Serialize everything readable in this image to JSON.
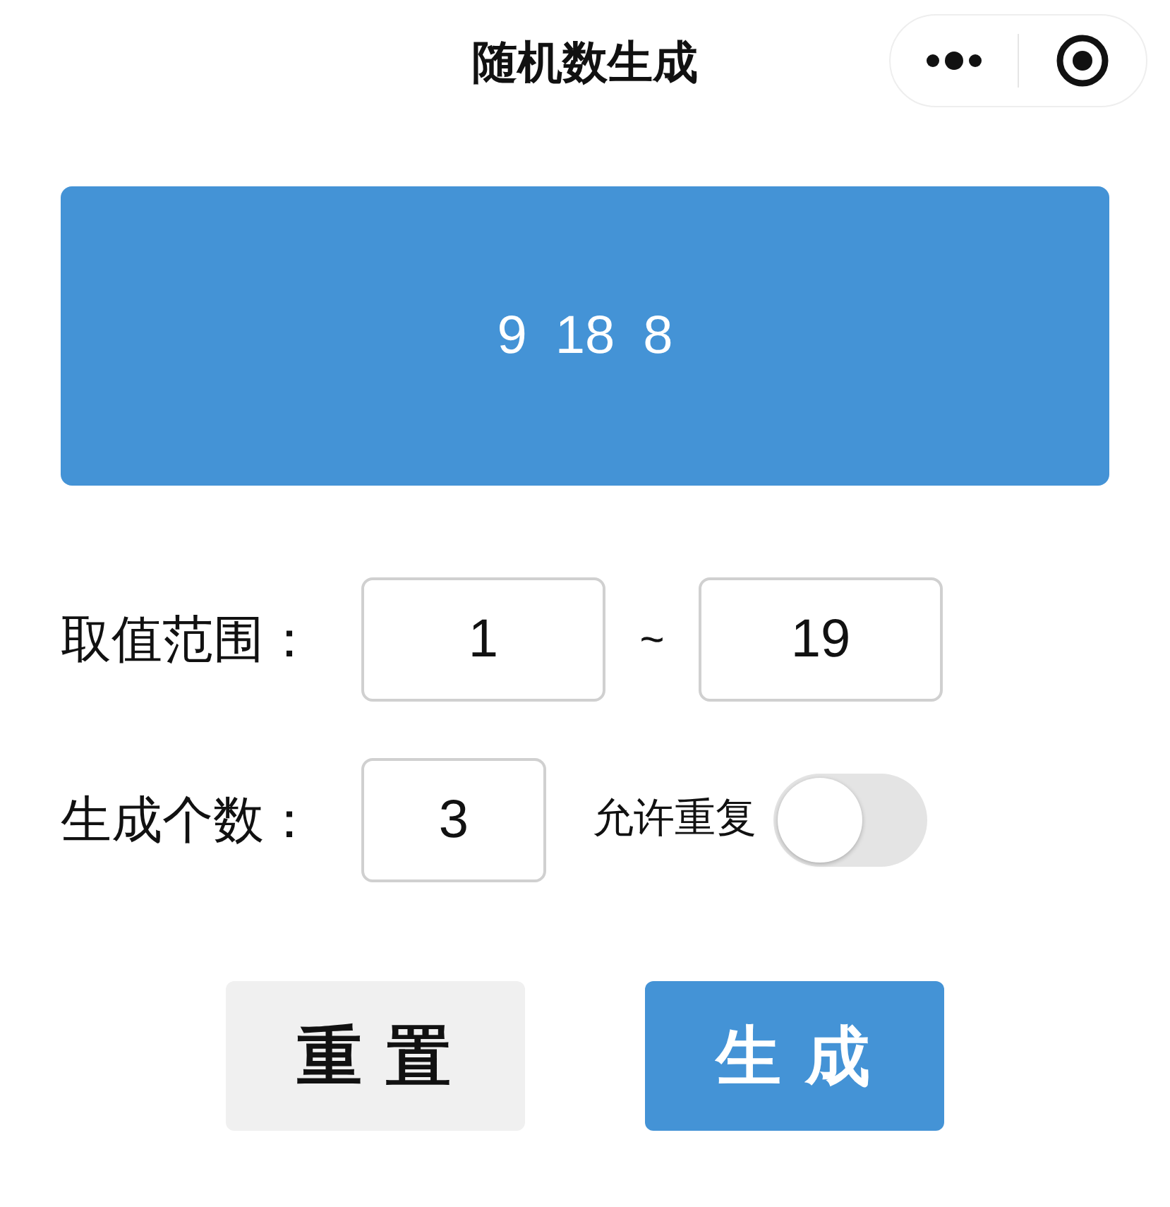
{
  "window": {
    "title": "随机数生成"
  },
  "results": [
    "9",
    "18",
    "8"
  ],
  "range": {
    "label": "取值范围：",
    "min": "1",
    "separator": "~",
    "max": "19"
  },
  "count": {
    "label": "生成个数：",
    "value": "3"
  },
  "allow_repeat": {
    "label": "允许重复",
    "on": false
  },
  "buttons": [
    {
      "label": "重 置",
      "kind": "secondary"
    },
    {
      "label": "生 成",
      "kind": "primary"
    }
  ]
}
